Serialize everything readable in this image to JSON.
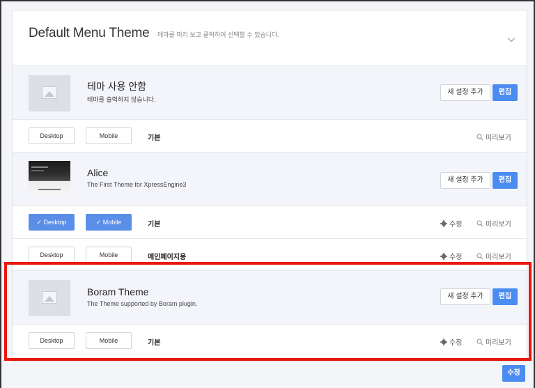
{
  "header": {
    "title": "Default Menu Theme",
    "description": "테마를 미리 보고 클릭하여 선택할 수 있습니다."
  },
  "themes": [
    {
      "name": "테마 사용 안함",
      "subtitle": "테마를 출력하지 않습니다.",
      "add_config_label": "새 설정 추가",
      "edit_label": "편집",
      "configs": [
        {
          "desktop_label": "Desktop",
          "mobile_label": "Mobile",
          "desktop_on": false,
          "mobile_on": false,
          "name": "기본",
          "edit_label": "",
          "preview_label": "미리보기"
        }
      ]
    },
    {
      "name": "Alice",
      "subtitle": "The First Theme for XpressEngine3",
      "add_config_label": "새 설정 추가",
      "edit_label": "편집",
      "configs": [
        {
          "desktop_label": "Desktop",
          "mobile_label": "Mobile",
          "desktop_on": true,
          "mobile_on": true,
          "name": "기본",
          "edit_label": "수정",
          "preview_label": "미리보기"
        },
        {
          "desktop_label": "Desktop",
          "mobile_label": "Mobile",
          "desktop_on": false,
          "mobile_on": false,
          "name": "메인페이지용",
          "edit_label": "수정",
          "preview_label": "미리보기"
        }
      ]
    },
    {
      "name": "Boram Theme",
      "subtitle": "The Theme supported by Boram plugin.",
      "add_config_label": "새 설정 추가",
      "edit_label": "편집",
      "configs": [
        {
          "desktop_label": "Desktop",
          "mobile_label": "Mobile",
          "desktop_on": false,
          "mobile_on": false,
          "name": "기본",
          "edit_label": "수정",
          "preview_label": "미리보기"
        }
      ]
    }
  ],
  "footer": {
    "save_label": "수정"
  },
  "colors": {
    "accent": "#4b8cf0",
    "highlight": "#e8170f",
    "row_bg": "#f4f5fa"
  },
  "icons": {
    "collapse": "chevron-down-icon",
    "edit": "gear-icon",
    "preview": "search-icon",
    "thumbnail": "image-placeholder-icon"
  }
}
